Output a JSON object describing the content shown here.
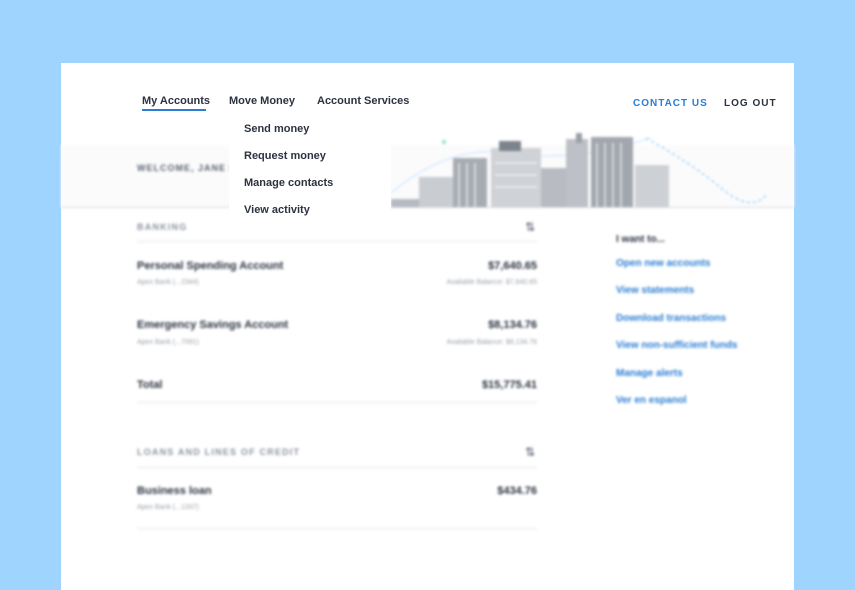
{
  "nav": {
    "my_accounts": "My Accounts",
    "move_money": "Move Money",
    "account_services": "Account Services",
    "contact_us": "CONTACT US",
    "log_out": "LOG OUT"
  },
  "dropdown": {
    "items": [
      "Send money",
      "Request money",
      "Manage contacts",
      "View activity"
    ]
  },
  "welcome": "WELCOME, JANE I",
  "banking": {
    "title": "BANKING",
    "sort_icon": "⇅",
    "accounts": [
      {
        "name": "Personal Spending Account",
        "bank": "Apex Bank (...2344)",
        "amount": "$7,640.65",
        "available": "Available Balance: $7,640.65"
      },
      {
        "name": "Emergency Savings Account",
        "bank": "Apex Bank (...7091)",
        "amount": "$8,134.76",
        "available": "Available Balance: $8,134.76"
      }
    ],
    "total_label": "Total",
    "total_amount": "$15,775.41"
  },
  "loans": {
    "title": "LOANS AND LINES OF CREDIT",
    "sort_icon": "⇅",
    "items": [
      {
        "name": "Business loan",
        "bank": "Apex Bank (...1337)",
        "amount": "$434.76"
      }
    ]
  },
  "quick_links": {
    "title": "I want to...",
    "items": [
      "Open new accounts",
      "View statements",
      "Download transactions",
      "View non-sufficient funds",
      "Manage alerts",
      "Ver en espanol"
    ]
  },
  "colors": {
    "background": "#9fd4ff",
    "accent": "#2a7dd4",
    "text": "#2b3340"
  },
  "icons": [
    "sort-icon",
    "city-skyline-illustration"
  ]
}
